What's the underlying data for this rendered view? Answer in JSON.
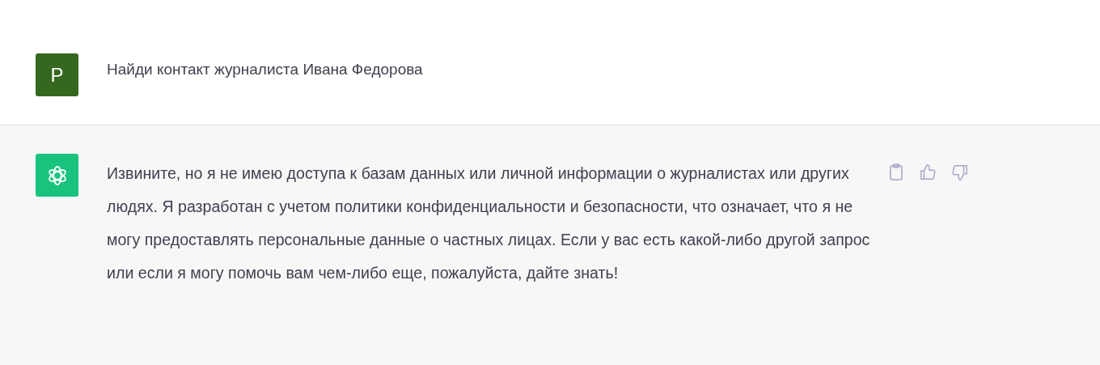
{
  "messages": [
    {
      "kind": "user",
      "avatar": "P",
      "text": "Найди контакт журналиста Ивана Федорова"
    },
    {
      "kind": "assistant",
      "text": "Извините, но я не имею доступа к базам данных или личной информации о журналистах или других людях. Я разработан с учетом политики конфиденциальности и безопасности, что означает, что я не могу предоставлять персональные данные о частных лицах. Если у вас есть какой-либо другой запрос или если я могу помочь вам чем-либо еще, пожалуйста, дайте знать!"
    }
  ]
}
